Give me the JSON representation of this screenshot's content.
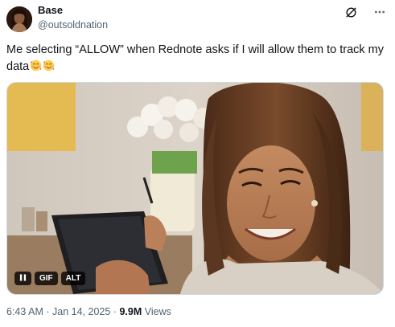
{
  "tweet": {
    "display_name": "Base",
    "handle": "@outsoldnation",
    "text": "Me selecting “ALLOW” when Rednote asks if I will allow them to track my data",
    "emoji": [
      "smiling-face-with-hearts",
      "smiling-face-with-hearts"
    ],
    "media": {
      "type": "gif",
      "pause_label": "",
      "gif_label": "GIF",
      "alt_label": "ALT"
    },
    "timestamp": "6:43 AM",
    "separator": "·",
    "date": "Jan 14, 2025",
    "views_count": "9.9M",
    "views_label": "Views"
  },
  "icons": {
    "grok": "slash-circle-icon",
    "more": "more-horizontal-icon",
    "pause": "pause-icon"
  },
  "colors": {
    "text_primary": "#0f1419",
    "text_secondary": "#536471",
    "border": "#cfd9de",
    "badge_bg": "#000000"
  }
}
